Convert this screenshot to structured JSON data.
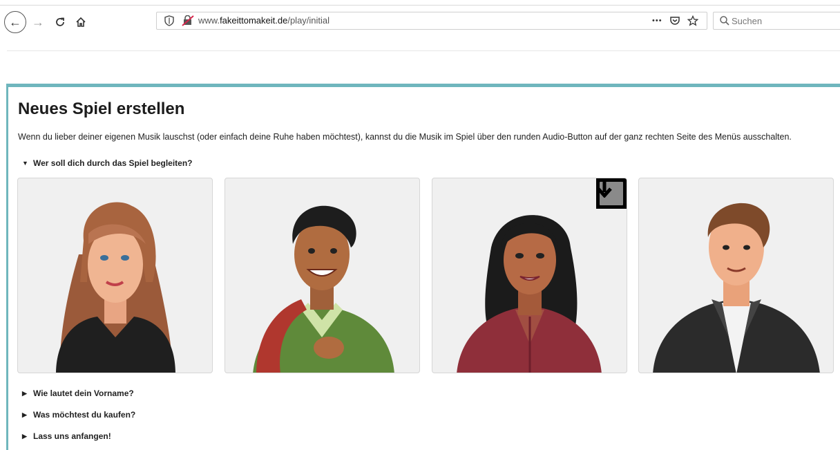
{
  "browser": {
    "url_prefix": "www.",
    "url_domain": "fakeittomakeit.de",
    "url_path": "/play/initial",
    "search_placeholder": "Suchen",
    "menu_dots": "•••"
  },
  "page": {
    "title": "Neues Spiel erstellen",
    "intro": "Wenn du lieber deiner eigenen Musik lauschst (oder einfach deine Ruhe haben möchtest), kannst du die Musik im Spiel über den runden Audio-Button auf der ganz rechten Seite des Menüs ausschalten.",
    "sections": [
      {
        "label": "Wer soll dich durch das Spiel begleiten?",
        "expanded": true
      },
      {
        "label": "Wie lautet dein Vorname?",
        "expanded": false
      },
      {
        "label": "Was möchtest du kaufen?",
        "expanded": false
      },
      {
        "label": "Lass uns anfangen!",
        "expanded": false
      }
    ],
    "companions": [
      {
        "name": "companion-woman-brown-hair",
        "selected": false
      },
      {
        "name": "companion-man-backpack",
        "selected": false
      },
      {
        "name": "companion-woman-dark-hair",
        "selected": true
      },
      {
        "name": "companion-man-jacket",
        "selected": false
      }
    ]
  },
  "colors": {
    "accent": "#6fb6bd",
    "card_bg": "#f0f0f0"
  }
}
